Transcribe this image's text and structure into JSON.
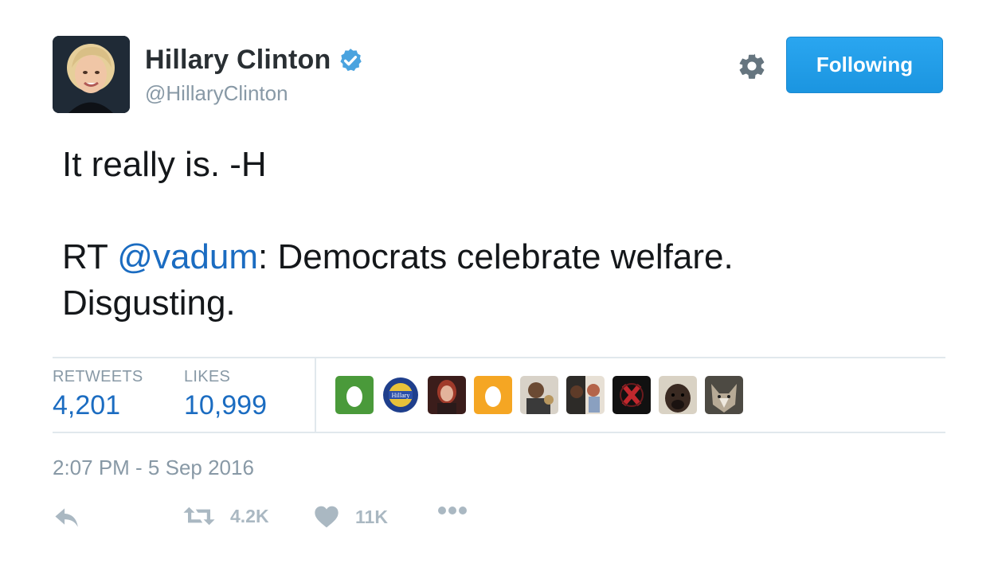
{
  "user": {
    "name": "Hillary Clinton",
    "handle": "@HillaryClinton",
    "follow_label": "Following"
  },
  "tweet": {
    "line1": "It really is. -H",
    "rt_prefix": "RT ",
    "mention": "@vadum",
    "rt_text": ": Democrats celebrate welfare.",
    "rt_text2": "Disgusting."
  },
  "stats": {
    "retweets_label": "RETWEETS",
    "retweets_value": "4,201",
    "likes_label": "LIKES",
    "likes_value": "10,999"
  },
  "likers": [
    "egg-green",
    "hillary-badge",
    "woman-portrait",
    "egg-orange",
    "man-portrait",
    "family-portrait",
    "red-x-logo",
    "dog-portrait",
    "wolf-portrait"
  ],
  "timestamp": "2:07 PM - 5 Sep 2016",
  "actions": {
    "retweet_count": "4.2K",
    "like_count": "11K"
  },
  "colors": {
    "accent": "#1da1f2",
    "link": "#1b6cc1",
    "muted": "#8899a6"
  }
}
